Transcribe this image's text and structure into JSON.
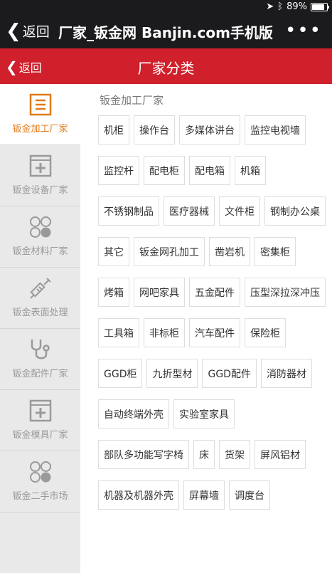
{
  "status_bar": {
    "battery": "89%"
  },
  "browser": {
    "back_label": "返回",
    "title": "厂家_钣金网 Banjin.com手机版",
    "more": "•••"
  },
  "header": {
    "back_label": "返回",
    "title": "厂家分类"
  },
  "sidebar": {
    "items": [
      {
        "label": "钣金加工厂家",
        "icon": "list-icon",
        "active": true
      },
      {
        "label": "钣金设备厂家",
        "icon": "plus-box-icon",
        "active": false
      },
      {
        "label": "钣金材料厂家",
        "icon": "circles-icon",
        "active": false
      },
      {
        "label": "钣金表面处理",
        "icon": "syringe-icon",
        "active": false
      },
      {
        "label": "钣金配件厂家",
        "icon": "stethoscope-icon",
        "active": false
      },
      {
        "label": "钣金模具厂家",
        "icon": "plus-box-icon",
        "active": false
      },
      {
        "label": "钣金二手市场",
        "icon": "circles-icon",
        "active": false
      }
    ]
  },
  "content": {
    "section_title": "钣金加工厂家",
    "tags": [
      "机柜",
      "操作台",
      "多媒体讲台",
      "监控电视墙",
      "监控杆",
      "配电柜",
      "配电箱",
      "机箱",
      "不锈钢制品",
      "医疗器械",
      "文件柜",
      "钢制办公桌",
      "其它",
      "钣金网孔加工",
      "凿岩机",
      "密集柜",
      "烤箱",
      "网吧家具",
      "五金配件",
      "压型深拉深冲压",
      "工具箱",
      "非标柜",
      "汽车配件",
      "保险柜",
      "GGD柜",
      "九折型材",
      "GGD配件",
      "消防器材",
      "自动终端外壳",
      "实验室家具",
      "部队多功能写字椅",
      "床",
      "货架",
      "屏风铝材",
      "机器及机器外壳",
      "屏幕墙",
      "调度台"
    ]
  },
  "colors": {
    "header_red": "#d0202b",
    "active_orange": "#e07a18",
    "sidebar_bg": "#e9e9e9"
  }
}
